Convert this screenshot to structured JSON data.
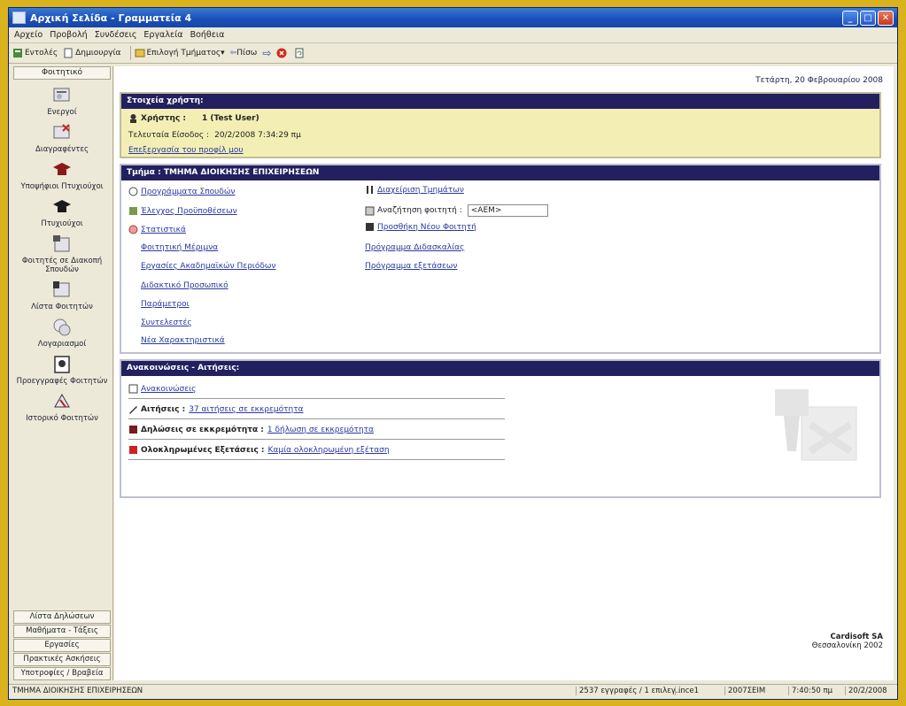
{
  "window": {
    "title": "Αρχική Σελίδα - Γραμματεία 4"
  },
  "menu": [
    "Αρχείο",
    "Προβολή",
    "Συνδέσεις",
    "Εργαλεία",
    "Βοήθεια"
  ],
  "toolbar": {
    "enter": "Εντολές",
    "create": "Δημιουργία",
    "select_dept": "Επιλογή Τμήματος",
    "back": "Πίσω"
  },
  "sidebar": {
    "header": "Φοιτητικό",
    "items": [
      {
        "label": "Ενεργοί",
        "icon": "students-icon"
      },
      {
        "label": "Διαγραφέντες",
        "icon": "deleted-students-icon"
      },
      {
        "label": "Υποψήφιοι Πτυχιούχοι",
        "icon": "candidate-graduates-icon"
      },
      {
        "label": "Πτυχιούχοι",
        "icon": "graduates-icon"
      },
      {
        "label": "Φοιτητές σε Διακοπή Σπουδών",
        "icon": "suspended-studies-icon"
      },
      {
        "label": "Λίστα Φοιτητών",
        "icon": "student-list-icon"
      },
      {
        "label": "Λογαριασμοί",
        "icon": "accounts-icon"
      },
      {
        "label": "Προεγγραφές Φοιτητών",
        "icon": "preregistration-icon"
      },
      {
        "label": "Ιστορικό Φοιτητών",
        "icon": "history-icon"
      }
    ],
    "bottom": [
      "Λίστα Δηλώσεων",
      "Μαθήματα - Τάξεις",
      "Εργασίες",
      "Πρακτικές Ασκήσεις",
      "Υποτροφίες / Βραβεία"
    ]
  },
  "main": {
    "date": "Τετάρτη, 20 Φεβρουαρίου 2008",
    "user_panel": {
      "title": "Στοιχεία χρήστη:",
      "user_label": "Χρήστης :",
      "user_value": "1 (Test User)",
      "last_login_label": "Τελευταία Είσοδος :",
      "last_login_value": "20/2/2008 7:34:29 πμ",
      "edit_link": "Επεξεργασία του προφίλ μου"
    },
    "dept_panel": {
      "title": "Τμήμα : ΤΜΗΜΑ ΔΙΟΙΚΗΣΗΣ ΕΠΙΧΕΙΡΗΣΕΩΝ",
      "left_links": [
        "Προγράμματα Σπουδών",
        "Έλεγχος Προϋποθέσεων",
        "Στατιστικά"
      ],
      "left_sublinks": [
        "Φοιτητική Μέριμνα",
        "Εργασίες Ακαδημαϊκών Περιόδων",
        "Διδακτικό Προσωπικό",
        "Παράμετροι",
        "Συντελεστές",
        "Νέα Χαρακτηριστικά"
      ],
      "right_links": [
        "Διαχείριση Τμημάτων"
      ],
      "search_label": "Αναζήτηση φοιτητή :",
      "search_value": "<AEM>",
      "add_student": "Προσθήκη Νέου Φοιτητή",
      "right_sublinks": [
        "Πρόγραμμα Διδασκαλίας",
        "Πρόγραμμα εξετάσεων"
      ]
    },
    "announce_panel": {
      "title": "Ανακοινώσεις - Αιτήσεις:",
      "rows": [
        {
          "bold": "",
          "link": "Ανακοινώσεις"
        },
        {
          "bold": "Αιτήσεις :",
          "link": "37 αιτήσεις σε εκκρεμότητα"
        },
        {
          "bold": "Δηλώσεις σε εκκρεμότητα :",
          "link": "1 δήλωση σε εκκρεμότητα"
        },
        {
          "bold": "Ολοκληρωμένες Εξετάσεις :",
          "link": "Καμία ολοκληρωμένη εξέταση"
        }
      ]
    },
    "company": "Cardisoft SA",
    "city": "Θεσσαλονίκη 2002"
  },
  "status": {
    "dept": "ΤΜΗΜΑ ΔΙΟΙΚΗΣΗΣ ΕΠΙΧΕΙΡΗΣΕΩΝ",
    "records": "2537 εγγραφές / 1 επιλεγ...",
    "user": "ince1",
    "period": "2007ΣΕΙΜ",
    "time": "7:40:50 πμ",
    "date": "20/2/2008"
  }
}
